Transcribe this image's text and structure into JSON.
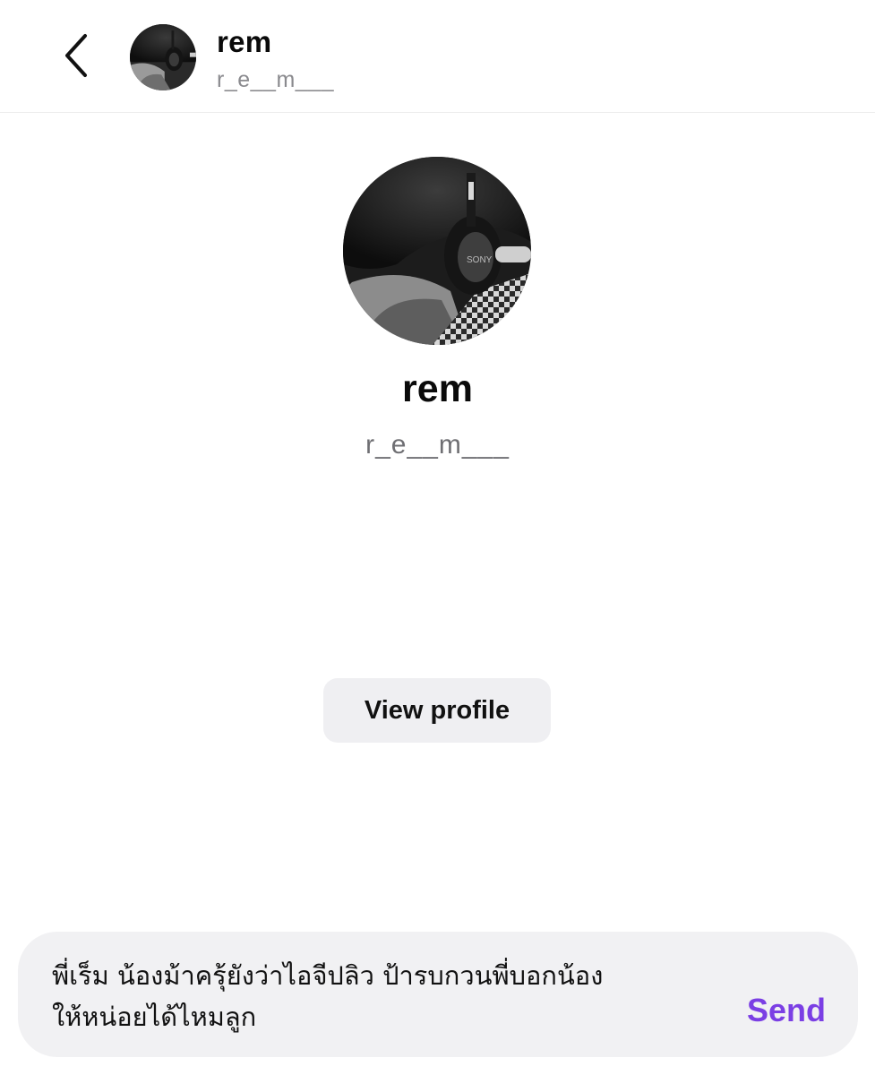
{
  "header": {
    "back_icon": "chevron-left-icon",
    "name": "rem",
    "handle": "r_e__m___"
  },
  "profile": {
    "name": "rem",
    "handle": "r_e__m___",
    "view_profile_label": "View profile"
  },
  "composer": {
    "text": "พี่เร็ม น้องม้าครุ้ยังว่าไอจีปลิว ป้ารบกวนพี่บอกน้อง\nให้หน่อยได้ไหมลูก",
    "send_label": "Send"
  },
  "colors": {
    "accent": "#7b3fe4",
    "button_bg": "#efeff2",
    "composer_bg": "#f1f1f3",
    "secondary_text": "#8a8a8e"
  }
}
